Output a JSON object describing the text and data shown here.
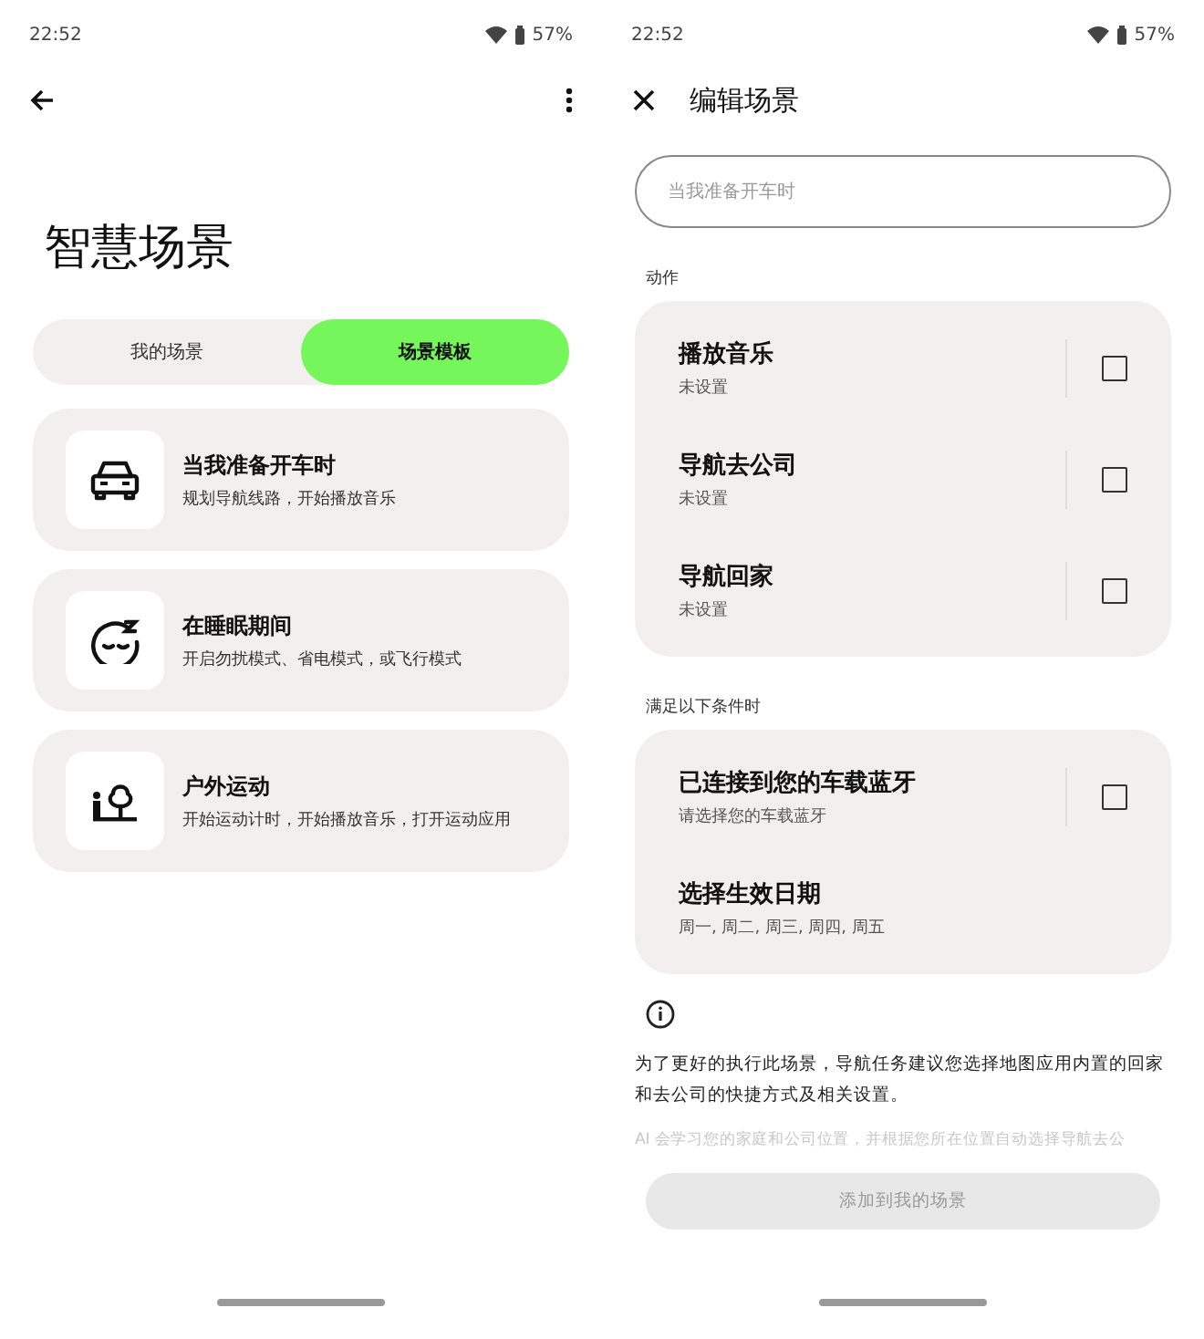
{
  "screens": [
    {
      "status_bar": {
        "time": "22:52",
        "battery": "57%"
      },
      "title": "智慧场景",
      "tabs": [
        {
          "label": "我的场景",
          "selected": false
        },
        {
          "label": "场景模板",
          "selected": true
        }
      ],
      "templates": [
        {
          "title": "当我准备开车时",
          "subtitle": "规划导航线路，开始播放音乐"
        },
        {
          "title": "在睡眠期间",
          "subtitle": "开启勿扰模式、省电模式，或飞行模式"
        },
        {
          "title": "户外运动",
          "subtitle": "开始运动计时，开始播放音乐，打开运动应用"
        }
      ]
    },
    {
      "status_bar": {
        "time": "22:52",
        "battery": "57%"
      },
      "top_bar": {
        "title": "编辑场景"
      },
      "name_field": {
        "placeholder": "当我准备开车时"
      },
      "sections": [
        {
          "label": "动作",
          "rows": [
            {
              "kind": "checkbox",
              "title": "播放音乐",
              "subtitle": "未设置",
              "checked": false
            },
            {
              "kind": "checkbox",
              "title": "导航去公司",
              "subtitle": "未设置",
              "checked": false
            },
            {
              "kind": "checkbox",
              "title": "导航回家",
              "subtitle": "未设置",
              "checked": false
            }
          ]
        },
        {
          "label": "满足以下条件时",
          "rows": [
            {
              "kind": "checkbox",
              "title": "已连接到您的车载蓝牙",
              "subtitle": "请选择您的车载蓝牙",
              "checked": false
            },
            {
              "kind": "plain",
              "title": "选择生效日期",
              "subtitle": "周一, 周二, 周三, 周四, 周五"
            }
          ]
        }
      ],
      "info": [
        "为了更好的执行此场景，导航任务建议您选择地图应用内置的回家和去公司的快捷方式及相关设置。",
        "AI 会学习您的家庭和公司位置，并根据您所在位置自动选择导航去公"
      ],
      "button": {
        "label": "添加到我的场景",
        "disabled": true
      }
    }
  ]
}
